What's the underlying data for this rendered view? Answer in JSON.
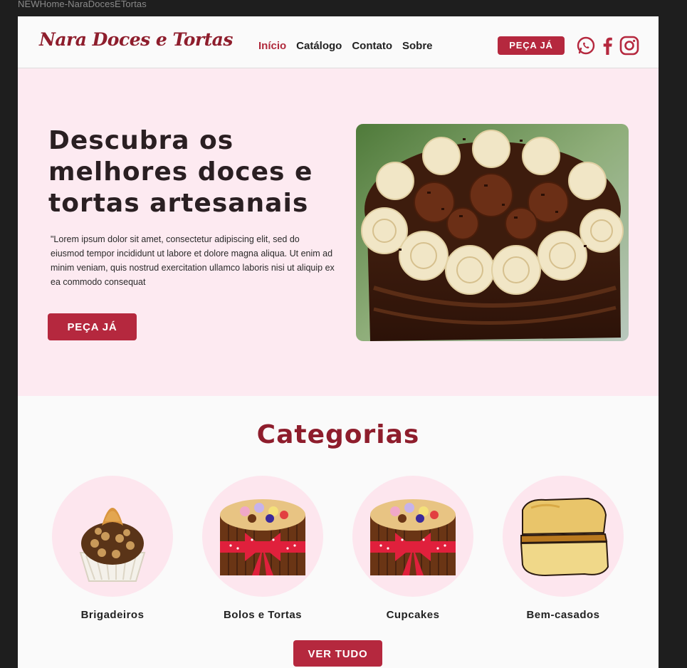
{
  "frame_title": "NEWHome-NaraDocesETortas",
  "header": {
    "brand": "Nara Doces e Tortas",
    "nav": [
      {
        "label": "Início"
      },
      {
        "label": "Catálogo"
      },
      {
        "label": "Contato"
      },
      {
        "label": "Sobre"
      }
    ],
    "cta_label": "PEÇA JÁ",
    "social": [
      "whatsapp-icon",
      "facebook-icon",
      "instagram-icon"
    ]
  },
  "hero": {
    "title": "Descubra os melhores doces e tortas artesanais",
    "text": "\"Lorem ipsum dolor sit amet, consectetur adipiscing elit, sed do eiusmod tempor incididunt ut labore et dolore magna aliqua. Ut enim ad minim veniam, quis nostrud exercitation ullamco laboris nisi ut aliquip ex ea commodo consequat",
    "cta_label": "PEÇA JÁ"
  },
  "categories": {
    "title": "Categorias",
    "items": [
      {
        "label": "Brigadeiros"
      },
      {
        "label": "Bolos e Tortas"
      },
      {
        "label": "Cupcakes"
      },
      {
        "label": "Bem-casados"
      }
    ],
    "see_all_label": "VER TUDO"
  },
  "colors": {
    "accent": "#b5283e",
    "brand": "#8e1d2c",
    "hero_bg": "#fdeaf1",
    "circle_bg": "#fde6ee"
  }
}
